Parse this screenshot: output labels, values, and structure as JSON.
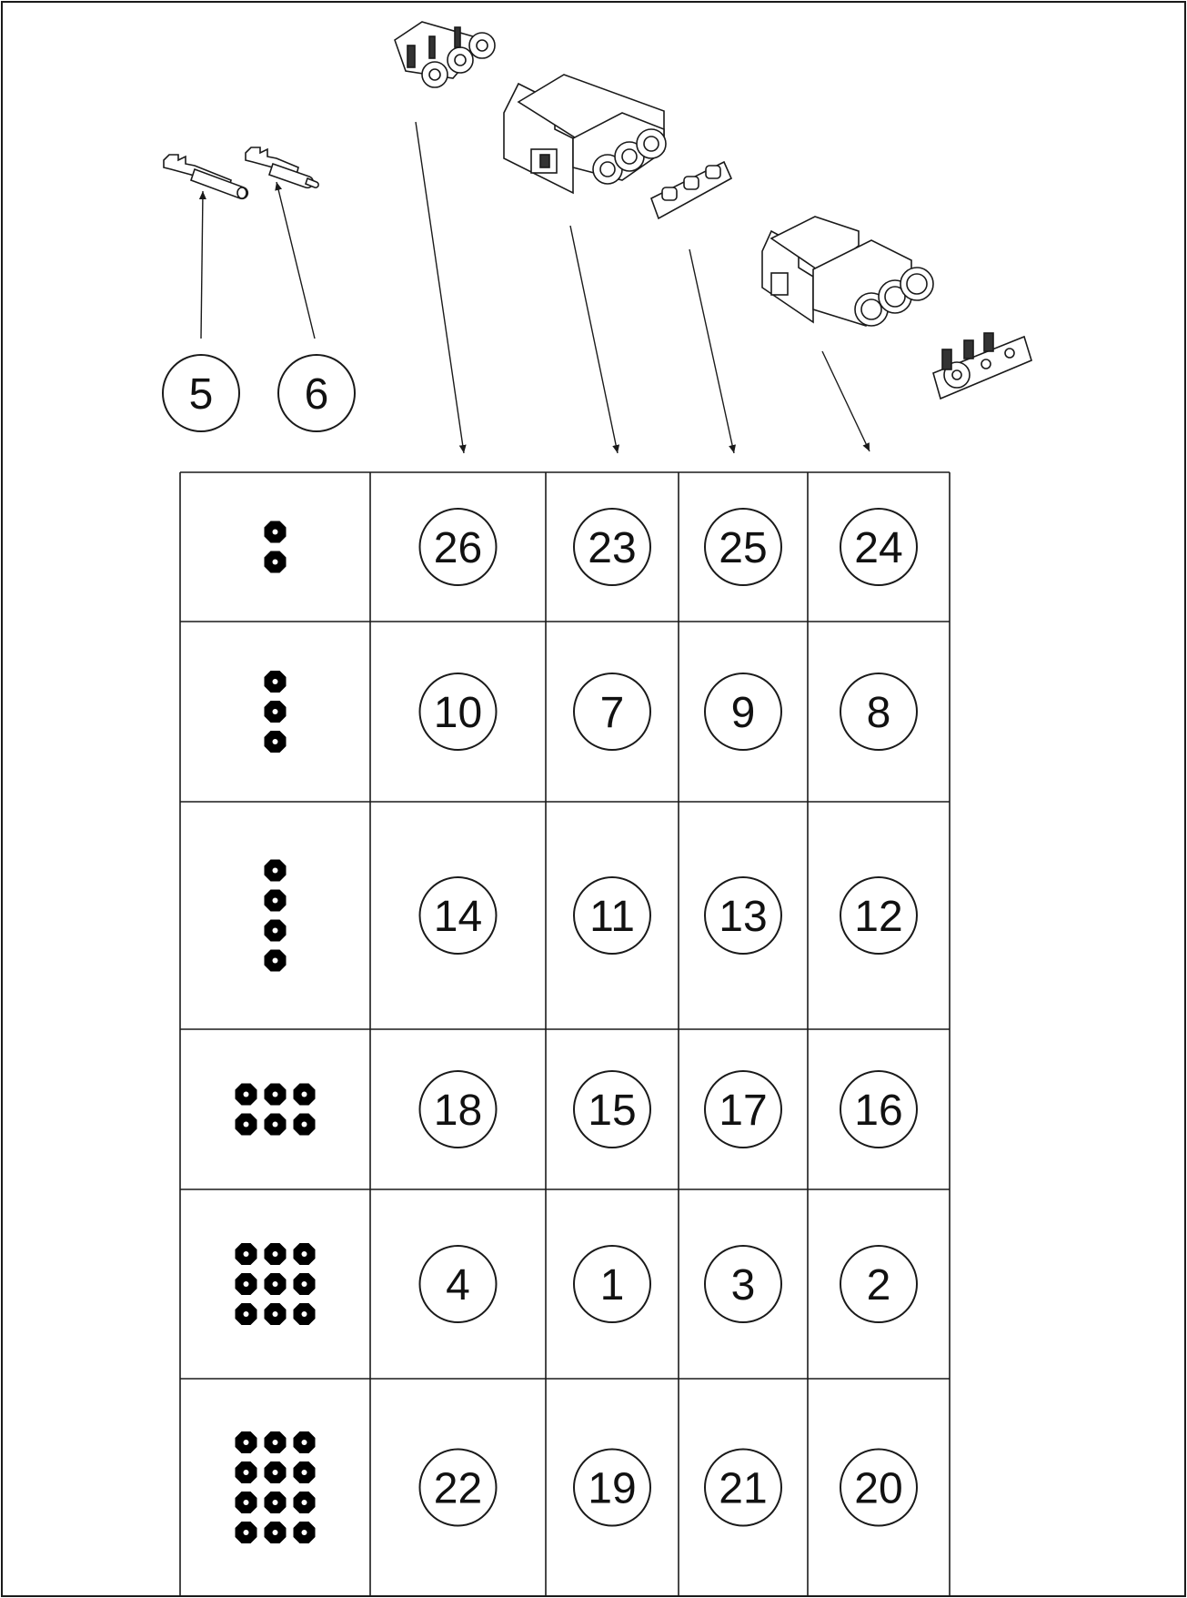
{
  "callouts": {
    "terminal_female": "5",
    "terminal_male": "6"
  },
  "table": {
    "rows": [
      {
        "pins": 2,
        "pin_layout": "1x2",
        "cells": [
          "26",
          "23",
          "25",
          "24"
        ]
      },
      {
        "pins": 3,
        "pin_layout": "1x3",
        "cells": [
          "10",
          "7",
          "9",
          "8"
        ]
      },
      {
        "pins": 4,
        "pin_layout": "1x4",
        "cells": [
          "14",
          "11",
          "13",
          "12"
        ]
      },
      {
        "pins": 6,
        "pin_layout": "3x2",
        "cells": [
          "18",
          "15",
          "17",
          "16"
        ]
      },
      {
        "pins": 9,
        "pin_layout": "3x3",
        "cells": [
          "4",
          "1",
          "3",
          "2"
        ]
      },
      {
        "pins": 12,
        "pin_layout": "3x4",
        "cells": [
          "22",
          "19",
          "21",
          "20"
        ]
      }
    ],
    "columns": [
      {
        "depicts": "seal-retainer"
      },
      {
        "depicts": "connector-housing"
      },
      {
        "depicts": "wedge-lock"
      },
      {
        "depicts": "mating-connector-housing"
      }
    ]
  },
  "colors": {
    "line": "#1a1a1a",
    "fill_pin": "#000000",
    "paper": "#ffffff"
  }
}
